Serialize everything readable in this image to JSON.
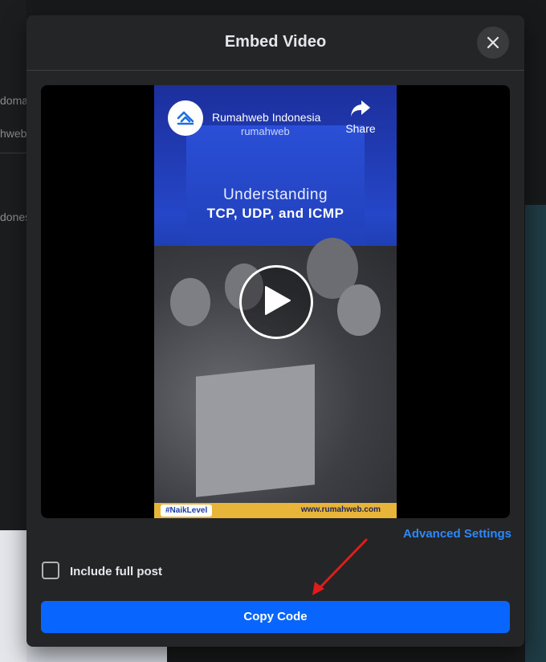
{
  "background": {
    "left_fragments": [
      "doma",
      "hweb",
      "dones"
    ]
  },
  "modal": {
    "title": "Embed Video",
    "close_icon": "close-icon",
    "accent_color": "#0866ff",
    "link_color": "#2d88ff"
  },
  "video": {
    "channel_name": "Rumahweb Indonesia",
    "brand_mark": "rumahweb",
    "share_label": "Share",
    "headline_line1": "Understanding",
    "headline_line2": "TCP, UDP, and ICMP",
    "hashtag": "#NaikLevel",
    "site_url": "www.rumahweb.com",
    "play_icon": "play-icon",
    "share_icon": "share-arrow-icon"
  },
  "settings": {
    "advanced_link": "Advanced Settings",
    "include_full_post_label": "Include full post",
    "include_full_post_checked": false
  },
  "actions": {
    "copy_code_label": "Copy Code"
  }
}
